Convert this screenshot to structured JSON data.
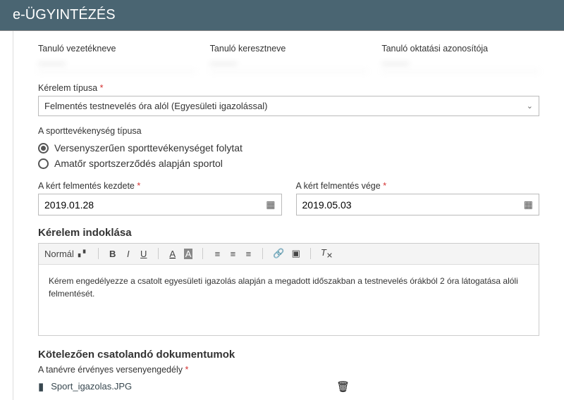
{
  "header": {
    "prefix": "e",
    "title": "-ÜGYINTÉZÉS"
  },
  "student": {
    "lastname_label": "Tanuló vezetékneve",
    "lastname_value": "———",
    "firstname_label": "Tanuló keresztneve",
    "firstname_value": "———",
    "eduid_label": "Tanuló oktatási azonosítója",
    "eduid_value": "———"
  },
  "request_type": {
    "label": "Kérelem típusa",
    "value": "Felmentés testnevelés óra alól (Egyesületi igazolással)"
  },
  "sport": {
    "label": "A sporttevékenység típusa",
    "options": [
      {
        "label": "Versenyszerűen sporttevékenységet folytat",
        "checked": true
      },
      {
        "label": "Amatőr sportszerződés alapján sportol",
        "checked": false
      }
    ]
  },
  "dates": {
    "start_label": "A kért felmentés kezdete",
    "start_value": "2019.01.28",
    "end_label": "A kért felmentés vége",
    "end_value": "2019.05.03"
  },
  "justification": {
    "title": "Kérelem indoklása",
    "toolbar": {
      "style": "Normál"
    },
    "body": "Kérem engedélyezze a csatolt egyesületi igazolás alapján a megadott időszakban a testnevelés órákból 2 óra látogatása alóli felmentését."
  },
  "attachments": {
    "title": "Kötelezően csatolandó dokumentumok",
    "label": "A tanévre érvényes versenyengedély",
    "file": "Sport_igazolas.JPG"
  }
}
